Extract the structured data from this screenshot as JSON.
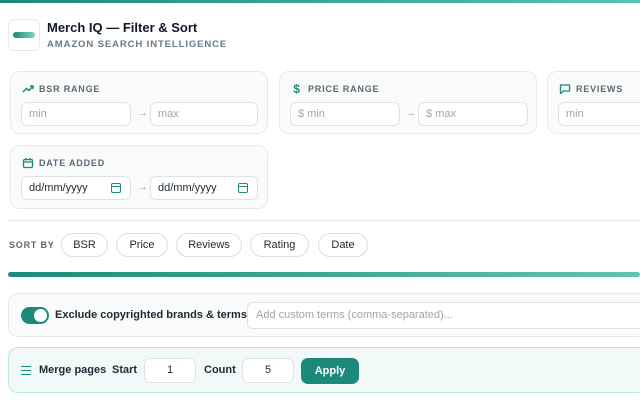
{
  "header": {
    "title": "Merch IQ — Filter & Sort",
    "subtitle": "AMAZON SEARCH INTELLIGENCE",
    "logo_icon": "merch-iq-logo"
  },
  "filters": {
    "bsr": {
      "label": "BSR RANGE",
      "icon": "trend-up-icon",
      "min_placeholder": "min",
      "max_placeholder": "max"
    },
    "price": {
      "label": "PRICE RANGE",
      "icon": "dollar-icon",
      "min_placeholder": "$ min",
      "max_placeholder": "$ max"
    },
    "reviews": {
      "label": "REVIEWS",
      "icon": "chat-icon",
      "min_placeholder": "min"
    },
    "date_added": {
      "label": "DATE ADDED",
      "icon": "calendar-icon",
      "from_value": "dd/mm/yyyy",
      "to_value": "dd/mm/yyyy"
    },
    "arrow": "→"
  },
  "sort": {
    "label": "SORT BY",
    "options": [
      "BSR",
      "Price",
      "Reviews",
      "Rating",
      "Date"
    ]
  },
  "progress": {
    "value": 1.0
  },
  "exclude": {
    "toggle_on": true,
    "label": "Exclude copyrighted brands & terms",
    "custom_placeholder": "Add custom terms (comma-separated)..."
  },
  "merge": {
    "label": "Merge pages",
    "start_label": "Start",
    "start_value": "1",
    "count_label": "Count",
    "count_value": "5",
    "apply_label": "Apply"
  },
  "colors": {
    "accent": "#1c8a7a",
    "accent_light": "#5ec5b4"
  }
}
